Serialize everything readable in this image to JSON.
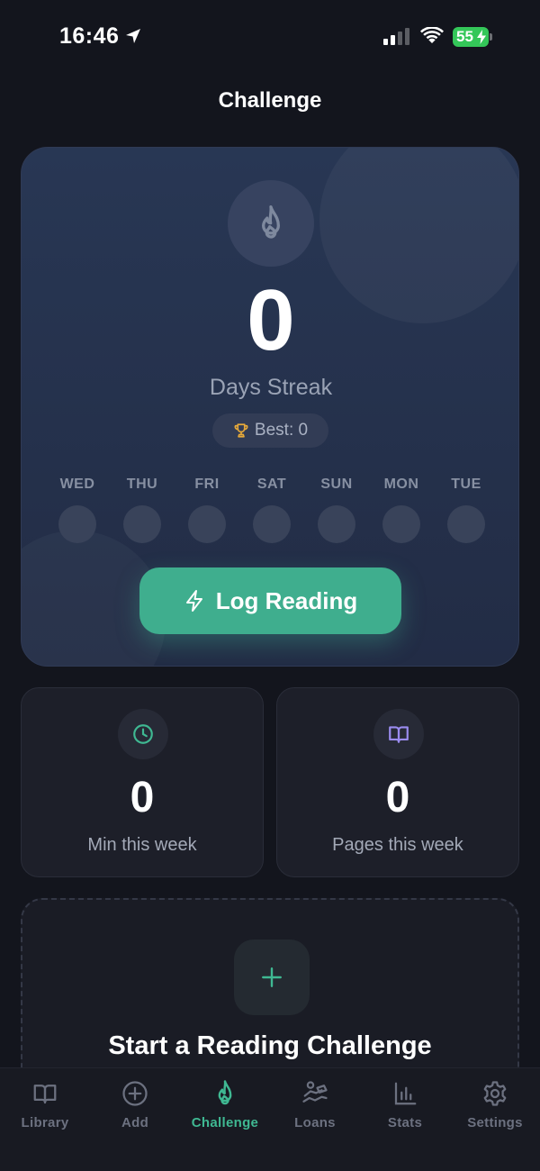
{
  "status_bar": {
    "time": "16:46",
    "battery": "55",
    "icons": [
      "location-arrow-icon",
      "cellular-signal-icon",
      "wifi-icon",
      "battery-charging-icon"
    ]
  },
  "header": {
    "title": "Challenge"
  },
  "streak": {
    "icon": "flame-icon",
    "count": "0",
    "label": "Days Streak",
    "best_icon": "trophy-icon",
    "best_label": "Best: 0",
    "days": [
      {
        "label": "WED",
        "completed": false
      },
      {
        "label": "THU",
        "completed": false
      },
      {
        "label": "FRI",
        "completed": false
      },
      {
        "label": "SAT",
        "completed": false
      },
      {
        "label": "SUN",
        "completed": false
      },
      {
        "label": "MON",
        "completed": false
      },
      {
        "label": "TUE",
        "completed": false
      }
    ],
    "log_button": {
      "icon": "lightning-icon",
      "label": "Log Reading"
    }
  },
  "stats": {
    "minutes": {
      "icon": "clock-icon",
      "value": "0",
      "label": "Min this week"
    },
    "pages": {
      "icon": "book-icon",
      "value": "0",
      "label": "Pages this week"
    }
  },
  "challenge": {
    "icon": "plus-icon",
    "title": "Start a Reading Challenge"
  },
  "tab_bar": {
    "active": "Challenge",
    "items": [
      {
        "label": "Library",
        "icon": "book-icon"
      },
      {
        "label": "Add",
        "icon": "plus-circle-icon"
      },
      {
        "label": "Challenge",
        "icon": "flame-icon"
      },
      {
        "label": "Loans",
        "icon": "hand-book-icon"
      },
      {
        "label": "Stats",
        "icon": "bar-chart-icon"
      },
      {
        "label": "Settings",
        "icon": "gear-icon"
      }
    ]
  },
  "colors": {
    "background": "#13151d",
    "accent": "#3fae8e",
    "accent_text": "#3fb892",
    "trophy": "#e6a93a",
    "clock": "#3fb892",
    "book": "#9b8cf0",
    "battery": "#34c759"
  }
}
